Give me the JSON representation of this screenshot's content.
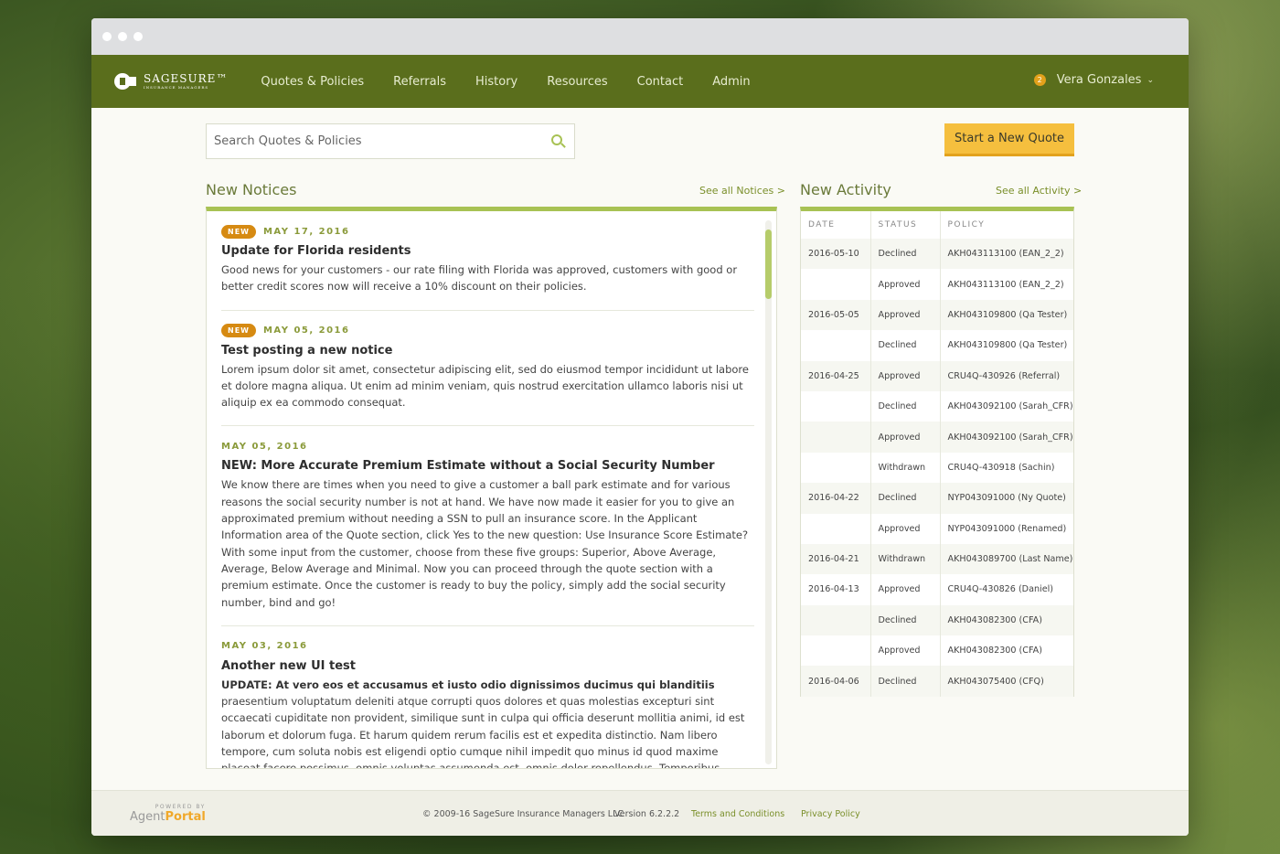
{
  "nav": {
    "logo_text": "SAGESURE",
    "logo_tm": "™",
    "logo_sub": "INSURANCE MANAGERS",
    "items": [
      "Quotes & Policies",
      "Referrals",
      "History",
      "Resources",
      "Contact",
      "Admin"
    ],
    "user_name": "Vera Gonzales",
    "notification_count": "2",
    "chevron": "⌄"
  },
  "search": {
    "placeholder": "Search Quotes & Policies"
  },
  "actions": {
    "new_quote_label": "Start a New Quote"
  },
  "notices_panel": {
    "title": "New Notices",
    "see_all": "See all Notices >",
    "new_badge": "NEW",
    "items": [
      {
        "is_new": true,
        "date": "MAY 17, 2016",
        "title": "Update for Florida residents",
        "body_bold": "",
        "body": "Good news for your customers - our rate filing with Florida was approved, customers with good or better credit scores now will receive a 10% discount on their policies."
      },
      {
        "is_new": true,
        "date": "MAY 05, 2016",
        "title": "Test posting a new notice",
        "body_bold": "",
        "body": "Lorem ipsum dolor sit amet, consectetur adipiscing elit, sed do eiusmod tempor incididunt ut labore et dolore magna aliqua. Ut enim ad minim veniam, quis nostrud exercitation ullamco laboris nisi ut aliquip ex ea commodo consequat."
      },
      {
        "is_new": false,
        "date": "MAY 05, 2016",
        "title": "NEW: More Accurate Premium Estimate without a Social Security Number",
        "body_bold": "",
        "body": "We know there are times when you need to give a customer a ball park estimate and for various reasons the social security number is not at hand. We have now made it easier for you to give an approximated premium without needing a SSN to pull an insurance score. In the Applicant Information area of the Quote section, click Yes to the new question: Use Insurance Score Estimate? With some input from the customer, choose from these five groups: Superior, Above Average, Average, Below Average and Minimal. Now you can proceed through the quote section with a premium estimate. Once the customer is ready to buy the policy, simply add the social security number, bind and go!"
      },
      {
        "is_new": false,
        "date": "MAY 03, 2016",
        "title": "Another new UI test",
        "body_bold": "UPDATE: At vero eos et accusamus et iusto odio dignissimos ducimus qui blanditiis",
        "body": " praesentium voluptatum deleniti atque corrupti quos dolores et quas molestias excepturi sint occaecati cupiditate non provident, similique sunt in culpa qui officia deserunt mollitia animi, id est laborum et dolorum fuga. Et harum quidem rerum facilis est et expedita distinctio. Nam libero tempore, cum soluta nobis est eligendi optio cumque nihil impedit quo minus id quod maxime placeat facere possimus, omnis voluptas assumenda est, omnis dolor repellendus. Temporibus autem quibusdam et aut officiis debitis aut rerum necessitatibus saepe eveniet ut et"
      }
    ]
  },
  "activity_panel": {
    "title": "New Activity",
    "see_all": "See all Activity >",
    "columns": [
      "DATE",
      "STATUS",
      "POLICY"
    ],
    "rows": [
      [
        "2016-05-10",
        "Declined",
        "AKH043113100 (EAN_2_2)"
      ],
      [
        "",
        "Approved",
        "AKH043113100 (EAN_2_2)"
      ],
      [
        "2016-05-05",
        "Approved",
        "AKH043109800 (Qa Tester)"
      ],
      [
        "",
        "Declined",
        "AKH043109800 (Qa Tester)"
      ],
      [
        "2016-04-25",
        "Approved",
        "CRU4Q-430926 (Referral)"
      ],
      [
        "",
        "Declined",
        "AKH043092100 (Sarah_CFR)"
      ],
      [
        "",
        "Approved",
        "AKH043092100 (Sarah_CFR)"
      ],
      [
        "",
        "Withdrawn",
        "CRU4Q-430918 (Sachin)"
      ],
      [
        "2016-04-22",
        "Declined",
        "NYP043091000 (Ny Quote)"
      ],
      [
        "",
        "Approved",
        "NYP043091000 (Renamed)"
      ],
      [
        "2016-04-21",
        "Withdrawn",
        "AKH043089700 (Last Name)"
      ],
      [
        "2016-04-13",
        "Approved",
        "CRU4Q-430826 (Daniel)"
      ],
      [
        "",
        "Declined",
        "AKH043082300 (CFA)"
      ],
      [
        "",
        "Approved",
        "AKH043082300 (CFA)"
      ],
      [
        "2016-04-06",
        "Declined",
        "AKH043075400 (CFQ)"
      ]
    ]
  },
  "footer": {
    "powered_by": "POWERED BY",
    "agent": "Agent",
    "portal": "Portal",
    "copyright": "© 2009-16 SageSure Insurance Managers LLC",
    "version": "Version 6.2.2.2",
    "terms": "Terms and Conditions",
    "privacy": "Privacy Policy"
  },
  "colors": {
    "nav_bg": "#5a6e1c",
    "accent": "#a8c254",
    "button": "#f5bf3e",
    "badge": "#d68a12"
  }
}
